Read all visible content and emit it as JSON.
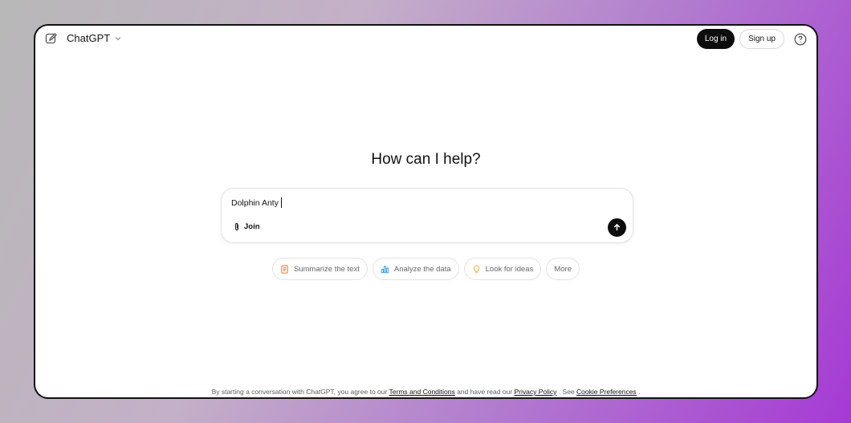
{
  "header": {
    "model_label": "ChatGPT",
    "login_label": "Log in",
    "signup_label": "Sign up"
  },
  "main": {
    "heading": "How can I help?",
    "composer": {
      "value": "Dolphin Anty",
      "attach_label": "Join"
    },
    "suggestions": [
      {
        "label": "Summarize the text",
        "icon": "document-icon",
        "color": "#e8743b"
      },
      {
        "label": "Analyze the data",
        "icon": "bar-chart-icon",
        "color": "#3aa3e8"
      },
      {
        "label": "Look for ideas",
        "icon": "lightbulb-icon",
        "color": "#e8b63b"
      },
      {
        "label": "More",
        "icon": "",
        "color": ""
      }
    ]
  },
  "footer": {
    "prefix": "By starting a conversation with ChatGPT, you agree to our",
    "terms_label": "Terms and Conditions",
    "middle": "and have read our",
    "privacy_label": "Privacy Policy",
    "see": ". See",
    "cookie_label": "Cookie Preferences",
    "suffix": "."
  },
  "colors": {
    "primary_button": "#0d0d0d",
    "window_bg": "#ffffff"
  }
}
